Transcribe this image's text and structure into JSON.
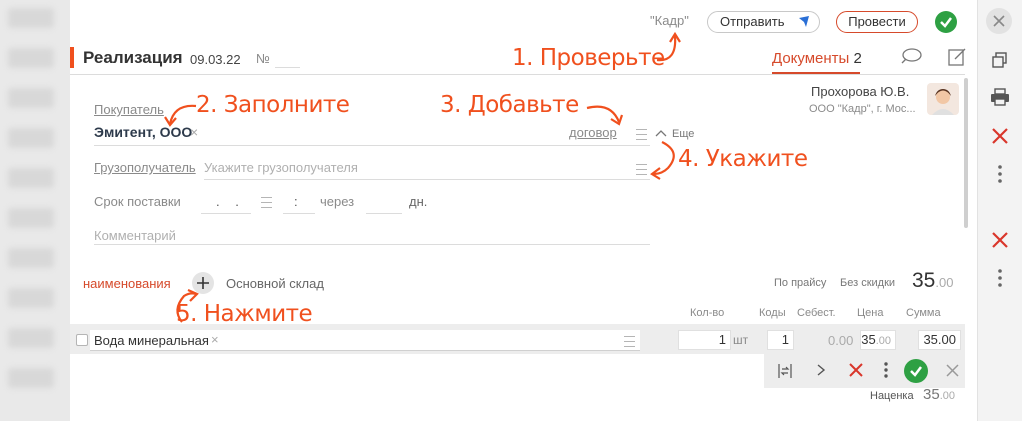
{
  "header": {
    "org_label": "\"Кадр\"",
    "send_label": "Отправить",
    "post_label": "Провести"
  },
  "doc": {
    "title": "Реализация",
    "date": "09.03.22",
    "number_label": "№"
  },
  "tabs": {
    "documents_label": "Документы",
    "documents_count": "2"
  },
  "author": {
    "name": "Прохорова Ю.В.",
    "org": "ООО \"Кадр\", г. Мос..."
  },
  "form": {
    "buyer_label": "Покупатель",
    "buyer_value": "Эмитент, ООО",
    "contract_link": "договор",
    "more_label": "Еще",
    "consignee_label": "Грузополучатель",
    "consignee_placeholder": "Укажите грузополучателя",
    "delivery_label": "Срок поставки",
    "date_mask": ". .",
    "time_mask": ":",
    "after_label": "через",
    "days_label": "дн.",
    "comment_placeholder": "Комментарий"
  },
  "items": {
    "names_label": "наименования",
    "warehouse": "Основной склад",
    "price_mode": "По прайсу",
    "discount": "Без скидки",
    "total_int": "35",
    "total_dec": ".00",
    "columns": [
      "Кол-во",
      "Коды",
      "Себест.",
      "Цена",
      "Сумма"
    ],
    "row": {
      "name": "Вода минеральная",
      "qty": "1",
      "unit": "шт",
      "codes": "1",
      "cost": "0.00",
      "price_int": "35",
      "price_dec": ".00",
      "sum": "35.00"
    },
    "markup_label": "Наценка",
    "markup_int": "35",
    "markup_dec": ".00"
  },
  "annotations": {
    "a1": "1. Проверьте",
    "a2": "2. Заполните",
    "a3": "3. Добавьте",
    "a4": "4. Укажите",
    "a5": "5. Нажмите"
  },
  "colors": {
    "accent": "#f0501e",
    "brand_red": "#d64a2b",
    "success": "#2ea043",
    "delete": "#d9362b"
  }
}
